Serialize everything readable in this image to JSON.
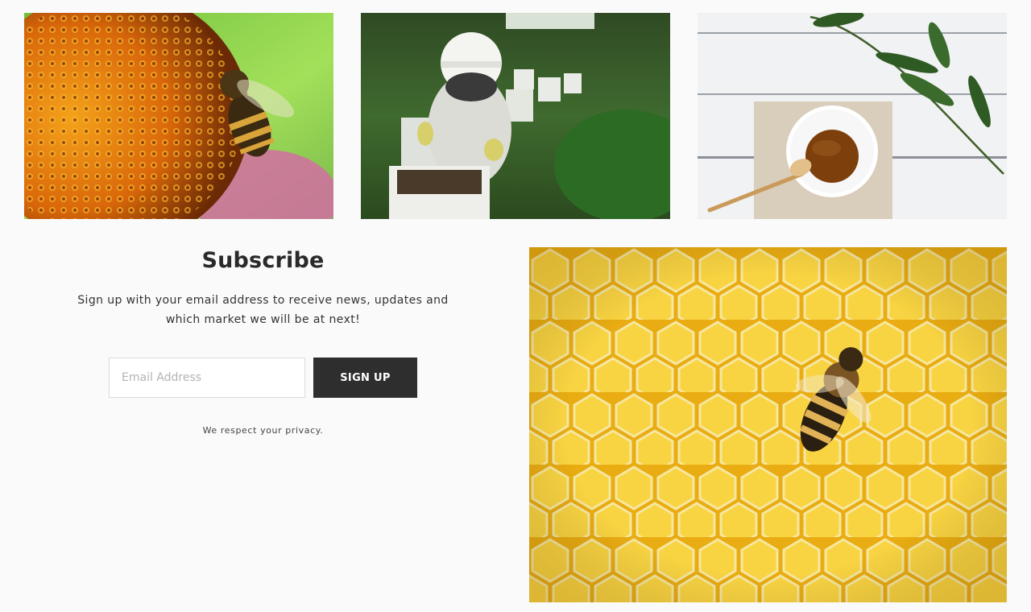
{
  "gallery": {
    "photos": [
      {
        "subject": "bee-on-coneflower"
      },
      {
        "subject": "beekeeper-at-hives"
      },
      {
        "subject": "honey-bowl-with-dipper"
      }
    ],
    "feature_photo": {
      "subject": "bee-on-honeycomb"
    }
  },
  "subscribe": {
    "title": "Subscribe",
    "description": "Sign up with your email address to receive news, updates and which market we will be at next!",
    "email_placeholder": "Email Address",
    "button_label": "SIGN UP",
    "privacy_note": "We respect your privacy."
  },
  "colors": {
    "background": "#fafafa",
    "button": "#2e2e2e",
    "button_text": "#ffffff",
    "honey": "#f2c41c"
  }
}
